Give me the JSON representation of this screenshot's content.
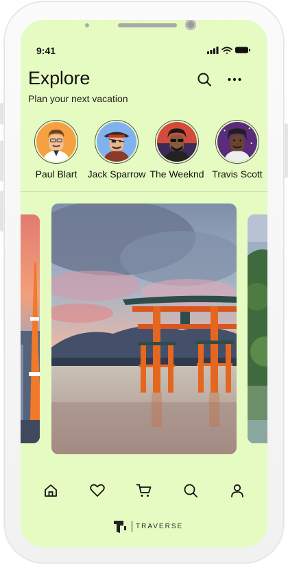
{
  "status_bar": {
    "time": "9:41"
  },
  "header": {
    "title": "Explore",
    "subtitle": "Plan your next vacation"
  },
  "stories": [
    {
      "name": "Paul Blart",
      "bg": "#f5a142"
    },
    {
      "name": "Jack Sparrow",
      "bg": "#7fb2ee"
    },
    {
      "name": "The Weeknd",
      "bg": "#d34b3c"
    },
    {
      "name": "Travis Scott",
      "bg": "#5a2c7a"
    }
  ],
  "destinations": [
    {
      "image": "tokyo-tower-at-sunset"
    },
    {
      "image": "itsukushima-torii-gate"
    },
    {
      "image": "japanese-garden"
    }
  ],
  "bottom_nav": [
    "home-icon",
    "heart-icon",
    "cart-icon",
    "search-icon",
    "profile-icon"
  ],
  "brand": {
    "name": "TRAVERSE"
  },
  "colors": {
    "screen_bg": "#e6fbc2",
    "text": "#111111"
  }
}
